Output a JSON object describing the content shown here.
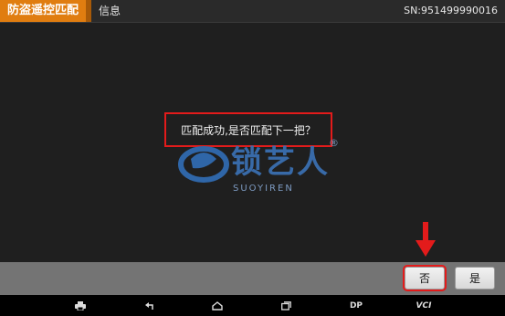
{
  "header": {
    "module_title": "防盗遥控匹配",
    "info_label": "信息",
    "serial": "SN:951499990016"
  },
  "dialog": {
    "message": "匹配成功,是否匹配下一把？"
  },
  "watermark": {
    "brand": "锁艺人",
    "sub": "SUOYIREN",
    "registered": "®"
  },
  "actions": {
    "no_label": "否",
    "yes_label": "是"
  },
  "navbar": {
    "dp_label": "DP",
    "vci_label": "VCI"
  },
  "colors": {
    "accent": "#e07d10",
    "highlight": "#e31b1b"
  }
}
